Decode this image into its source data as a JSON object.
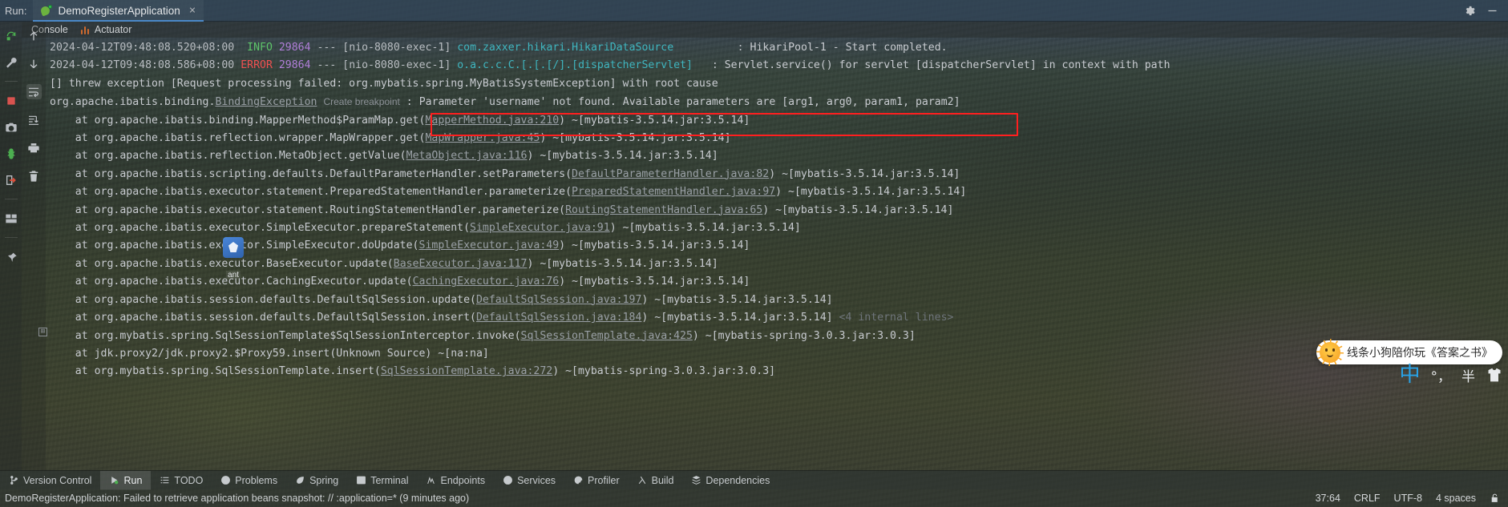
{
  "window": {
    "run_label": "Run:",
    "tab_title": "DemoRegisterApplication",
    "close_glyph": "×",
    "gear_icon": "gear-icon",
    "minimize_icon": "minimize-icon"
  },
  "tabstrip": {
    "tabs": [
      {
        "label": "Console",
        "icon": "console-icon",
        "active": true
      },
      {
        "label": "Actuator",
        "icon": "actuator-icon",
        "active": false
      }
    ]
  },
  "left_toolbar_primary": [
    {
      "name": "rerun-icon",
      "title": "Rerun"
    },
    {
      "name": "wrench-icon",
      "title": "Settings"
    },
    {
      "name": "stop-icon",
      "title": "Stop"
    },
    {
      "name": "camera-icon",
      "title": "Screenshot"
    },
    {
      "name": "thread-dump-icon",
      "title": "Thread Dump"
    },
    {
      "name": "exit-icon",
      "title": "Exit"
    },
    {
      "name": "layout-icon",
      "title": "Layout"
    },
    {
      "name": "pin-icon",
      "title": "Pin Tab"
    }
  ],
  "left_toolbar_secondary": [
    {
      "name": "arrow-up-icon",
      "title": "Up the Stack Trace"
    },
    {
      "name": "arrow-down-icon",
      "title": "Down the Stack Trace"
    },
    {
      "name": "soft-wrap-icon",
      "title": "Soft-Wrap",
      "selected": true
    },
    {
      "name": "scroll-to-end-icon",
      "title": "Scroll to End"
    },
    {
      "name": "print-icon",
      "title": "Print"
    },
    {
      "name": "trash-icon",
      "title": "Clear All"
    }
  ],
  "console": {
    "lines": [
      {
        "type": "log",
        "timestamp": "2024-04-12T09:48:08.520+08:00",
        "level": "INFO",
        "level_color": "#5ec46a",
        "pid": "29864",
        "separator": "---",
        "thread": "[nio-8080-exec-1]",
        "logger": "com.zaxxer.hikari.HikariDataSource",
        "colon": ":",
        "message": "HikariPool-1 - Start completed."
      },
      {
        "type": "log",
        "timestamp": "2024-04-12T09:48:08.586+08:00",
        "level": "ERROR",
        "level_color": "#f05050",
        "pid": "29864",
        "separator": "---",
        "thread": "[nio-8080-exec-1]",
        "logger": "o.a.c.c.C.[.[.[/].[dispatcherServlet]",
        "colon": ":",
        "message": "Servlet.service() for servlet [dispatcherServlet] in context with path"
      },
      {
        "type": "plain",
        "text": "[] threw exception [Request processing failed: org.mybatis.spring.MyBatisSystemException] with root cause"
      },
      {
        "type": "blank",
        "text": ""
      },
      {
        "type": "exception",
        "prefix": "org.apache.ibatis.binding.",
        "link": "BindingException",
        "breakpoint_hint": "Create breakpoint",
        "colon": ":",
        "message": "Parameter 'username' not found. Available parameters are [arg1, arg0, param1, param2]",
        "highlighted": true
      },
      {
        "type": "stack",
        "pre": "    at org.apache.ibatis.binding.MapperMethod$ParamMap.get(",
        "link": "MapperMethod.java:210",
        "post": ") ~[mybatis-3.5.14.jar:3.5.14]"
      },
      {
        "type": "stack",
        "pre": "    at org.apache.ibatis.reflection.wrapper.MapWrapper.get(",
        "link": "MapWrapper.java:45",
        "post": ") ~[mybatis-3.5.14.jar:3.5.14]"
      },
      {
        "type": "stack",
        "pre": "    at org.apache.ibatis.reflection.MetaObject.getValue(",
        "link": "MetaObject.java:116",
        "post": ") ~[mybatis-3.5.14.jar:3.5.14]"
      },
      {
        "type": "stack",
        "pre": "    at org.apache.ibatis.scripting.defaults.DefaultParameterHandler.setParameters(",
        "link": "DefaultParameterHandler.java:82",
        "post": ") ~[mybatis-3.5.14.jar:3.5.14]"
      },
      {
        "type": "stack",
        "pre": "    at org.apache.ibatis.executor.statement.PreparedStatementHandler.parameterize(",
        "link": "PreparedStatementHandler.java:97",
        "post": ") ~[mybatis-3.5.14.jar:3.5.14]"
      },
      {
        "type": "stack",
        "pre": "    at org.apache.ibatis.executor.statement.RoutingStatementHandler.parameterize(",
        "link": "RoutingStatementHandler.java:65",
        "post": ") ~[mybatis-3.5.14.jar:3.5.14]"
      },
      {
        "type": "stack",
        "pre": "    at org.apache.ibatis.executor.SimpleExecutor.prepareStatement(",
        "link": "SimpleExecutor.java:91",
        "post": ") ~[mybatis-3.5.14.jar:3.5.14]"
      },
      {
        "type": "stack",
        "pre": "    at org.apache.ibatis.executor.SimpleExecutor.doUpdate(",
        "link": "SimpleExecutor.java:49",
        "post": ") ~[mybatis-3.5.14.jar:3.5.14]"
      },
      {
        "type": "stack",
        "pre": "    at org.apache.ibatis.executor.BaseExecutor.update(",
        "link": "BaseExecutor.java:117",
        "post": ") ~[mybatis-3.5.14.jar:3.5.14]"
      },
      {
        "type": "stack",
        "pre": "    at org.apache.ibatis.executor.CachingExecutor.update(",
        "link": "CachingExecutor.java:76",
        "post": ") ~[mybatis-3.5.14.jar:3.5.14]"
      },
      {
        "type": "stack",
        "pre": "    at org.apache.ibatis.session.defaults.DefaultSqlSession.update(",
        "link": "DefaultSqlSession.java:197",
        "post": ") ~[mybatis-3.5.14.jar:3.5.14]"
      },
      {
        "type": "stack",
        "pre": "    at org.apache.ibatis.session.defaults.DefaultSqlSession.insert(",
        "link": "DefaultSqlSession.java:184",
        "post": ") ~[mybatis-3.5.14.jar:3.5.14]",
        "extra": "<4 internal lines>"
      },
      {
        "type": "stack",
        "pre": "    at org.mybatis.spring.SqlSessionTemplate$SqlSessionInterceptor.invoke(",
        "link": "SqlSessionTemplate.java:425",
        "post": ") ~[mybatis-spring-3.0.3.jar:3.0.3]"
      },
      {
        "type": "plain",
        "text": "    at jdk.proxy2/jdk.proxy2.$Proxy59.insert(Unknown Source) ~[na:na]"
      },
      {
        "type": "stack",
        "pre": "    at org.mybatis.spring.SqlSessionTemplate.insert(",
        "link": "SqlSessionTemplate.java:272",
        "post": ") ~[mybatis-spring-3.0.3.jar:3.0.3]"
      }
    ]
  },
  "gutter": {
    "fold_glyph": "⊞"
  },
  "ant_badge": {
    "label": "ant",
    "icon": "ant-build-icon"
  },
  "ime": {
    "promo_text": "线条小狗陪你玩《答案之书》",
    "sun_icon": "sun-face-icon",
    "mode_zh": "中",
    "punctuation": "°，",
    "width_mode": "半",
    "skin_icon": "shirt-icon"
  },
  "bottom_bar": {
    "items": [
      {
        "label": "Version Control",
        "icon": "branch-icon",
        "active": false
      },
      {
        "label": "Run",
        "icon": "run-icon",
        "active": true
      },
      {
        "label": "TODO",
        "icon": "todo-icon",
        "active": false
      },
      {
        "label": "Problems",
        "icon": "problems-icon",
        "active": false
      },
      {
        "label": "Spring",
        "icon": "spring-leaf-icon",
        "active": false
      },
      {
        "label": "Terminal",
        "icon": "terminal-icon",
        "active": false
      },
      {
        "label": "Endpoints",
        "icon": "endpoints-icon",
        "active": false
      },
      {
        "label": "Services",
        "icon": "services-icon",
        "active": false
      },
      {
        "label": "Profiler",
        "icon": "profiler-icon",
        "active": false
      },
      {
        "label": "Build",
        "icon": "build-hammer-icon",
        "active": false
      },
      {
        "label": "Dependencies",
        "icon": "dependencies-icon",
        "active": false
      }
    ]
  },
  "status_bar": {
    "message": "DemoRegisterApplication: Failed to retrieve application beans snapshot: // :application=* (9 minutes ago)",
    "caret_position": "37:64",
    "line_separator": "CRLF",
    "encoding": "UTF-8",
    "indent": "4 spaces",
    "lock_icon": "lock-icon"
  }
}
